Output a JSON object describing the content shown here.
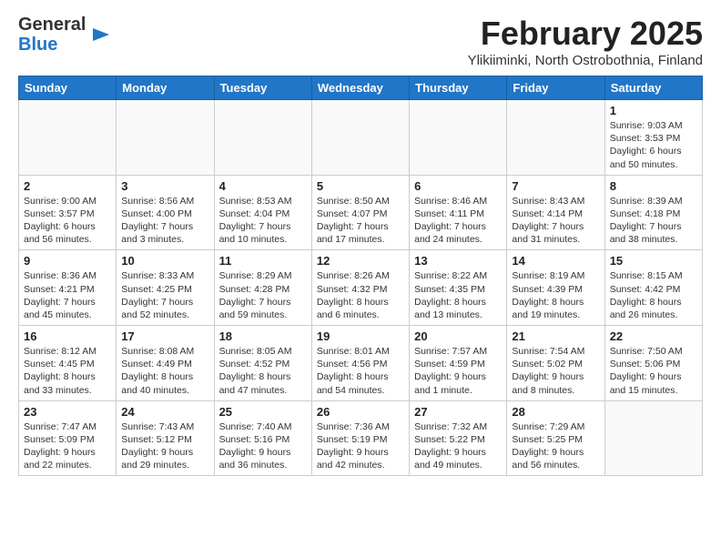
{
  "header": {
    "logo_general": "General",
    "logo_blue": "Blue",
    "title": "February 2025",
    "subtitle": "Ylikiiminki, North Ostrobothnia, Finland"
  },
  "weekdays": [
    "Sunday",
    "Monday",
    "Tuesday",
    "Wednesday",
    "Thursday",
    "Friday",
    "Saturday"
  ],
  "weeks": [
    [
      {
        "day": "",
        "info": ""
      },
      {
        "day": "",
        "info": ""
      },
      {
        "day": "",
        "info": ""
      },
      {
        "day": "",
        "info": ""
      },
      {
        "day": "",
        "info": ""
      },
      {
        "day": "",
        "info": ""
      },
      {
        "day": "1",
        "info": "Sunrise: 9:03 AM\nSunset: 3:53 PM\nDaylight: 6 hours and 50 minutes."
      }
    ],
    [
      {
        "day": "2",
        "info": "Sunrise: 9:00 AM\nSunset: 3:57 PM\nDaylight: 6 hours and 56 minutes."
      },
      {
        "day": "3",
        "info": "Sunrise: 8:56 AM\nSunset: 4:00 PM\nDaylight: 7 hours and 3 minutes."
      },
      {
        "day": "4",
        "info": "Sunrise: 8:53 AM\nSunset: 4:04 PM\nDaylight: 7 hours and 10 minutes."
      },
      {
        "day": "5",
        "info": "Sunrise: 8:50 AM\nSunset: 4:07 PM\nDaylight: 7 hours and 17 minutes."
      },
      {
        "day": "6",
        "info": "Sunrise: 8:46 AM\nSunset: 4:11 PM\nDaylight: 7 hours and 24 minutes."
      },
      {
        "day": "7",
        "info": "Sunrise: 8:43 AM\nSunset: 4:14 PM\nDaylight: 7 hours and 31 minutes."
      },
      {
        "day": "8",
        "info": "Sunrise: 8:39 AM\nSunset: 4:18 PM\nDaylight: 7 hours and 38 minutes."
      }
    ],
    [
      {
        "day": "9",
        "info": "Sunrise: 8:36 AM\nSunset: 4:21 PM\nDaylight: 7 hours and 45 minutes."
      },
      {
        "day": "10",
        "info": "Sunrise: 8:33 AM\nSunset: 4:25 PM\nDaylight: 7 hours and 52 minutes."
      },
      {
        "day": "11",
        "info": "Sunrise: 8:29 AM\nSunset: 4:28 PM\nDaylight: 7 hours and 59 minutes."
      },
      {
        "day": "12",
        "info": "Sunrise: 8:26 AM\nSunset: 4:32 PM\nDaylight: 8 hours and 6 minutes."
      },
      {
        "day": "13",
        "info": "Sunrise: 8:22 AM\nSunset: 4:35 PM\nDaylight: 8 hours and 13 minutes."
      },
      {
        "day": "14",
        "info": "Sunrise: 8:19 AM\nSunset: 4:39 PM\nDaylight: 8 hours and 19 minutes."
      },
      {
        "day": "15",
        "info": "Sunrise: 8:15 AM\nSunset: 4:42 PM\nDaylight: 8 hours and 26 minutes."
      }
    ],
    [
      {
        "day": "16",
        "info": "Sunrise: 8:12 AM\nSunset: 4:45 PM\nDaylight: 8 hours and 33 minutes."
      },
      {
        "day": "17",
        "info": "Sunrise: 8:08 AM\nSunset: 4:49 PM\nDaylight: 8 hours and 40 minutes."
      },
      {
        "day": "18",
        "info": "Sunrise: 8:05 AM\nSunset: 4:52 PM\nDaylight: 8 hours and 47 minutes."
      },
      {
        "day": "19",
        "info": "Sunrise: 8:01 AM\nSunset: 4:56 PM\nDaylight: 8 hours and 54 minutes."
      },
      {
        "day": "20",
        "info": "Sunrise: 7:57 AM\nSunset: 4:59 PM\nDaylight: 9 hours and 1 minute."
      },
      {
        "day": "21",
        "info": "Sunrise: 7:54 AM\nSunset: 5:02 PM\nDaylight: 9 hours and 8 minutes."
      },
      {
        "day": "22",
        "info": "Sunrise: 7:50 AM\nSunset: 5:06 PM\nDaylight: 9 hours and 15 minutes."
      }
    ],
    [
      {
        "day": "23",
        "info": "Sunrise: 7:47 AM\nSunset: 5:09 PM\nDaylight: 9 hours and 22 minutes."
      },
      {
        "day": "24",
        "info": "Sunrise: 7:43 AM\nSunset: 5:12 PM\nDaylight: 9 hours and 29 minutes."
      },
      {
        "day": "25",
        "info": "Sunrise: 7:40 AM\nSunset: 5:16 PM\nDaylight: 9 hours and 36 minutes."
      },
      {
        "day": "26",
        "info": "Sunrise: 7:36 AM\nSunset: 5:19 PM\nDaylight: 9 hours and 42 minutes."
      },
      {
        "day": "27",
        "info": "Sunrise: 7:32 AM\nSunset: 5:22 PM\nDaylight: 9 hours and 49 minutes."
      },
      {
        "day": "28",
        "info": "Sunrise: 7:29 AM\nSunset: 5:25 PM\nDaylight: 9 hours and 56 minutes."
      },
      {
        "day": "",
        "info": ""
      }
    ]
  ]
}
